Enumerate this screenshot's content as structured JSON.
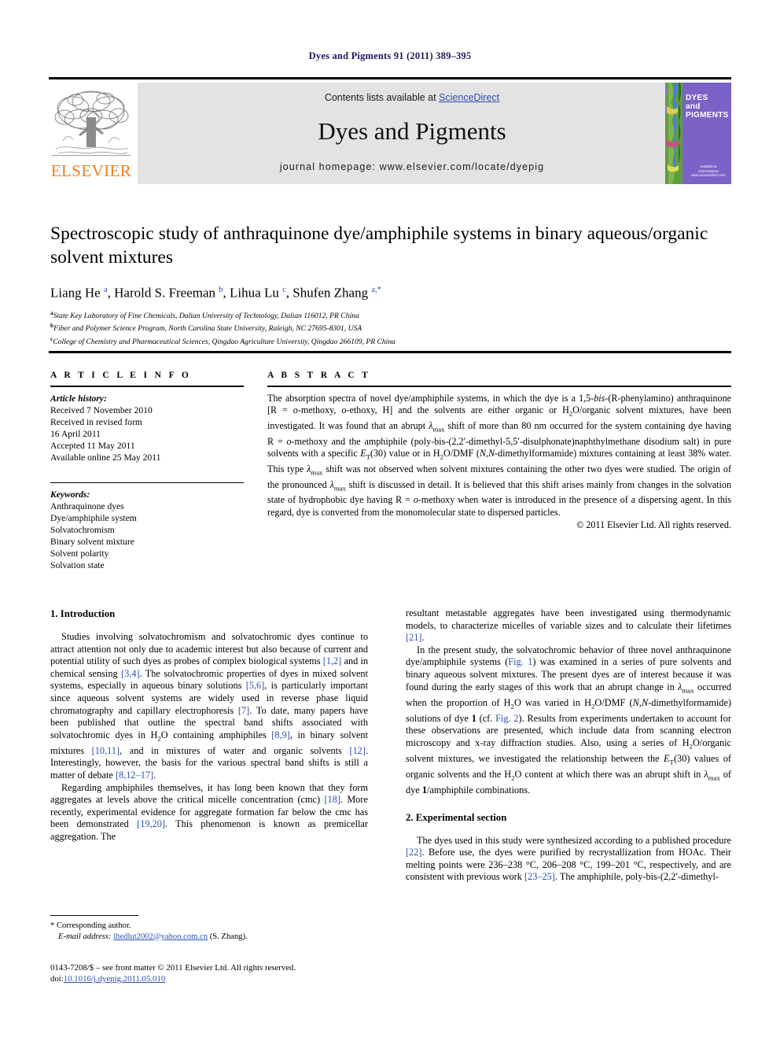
{
  "running_head": "Dyes and Pigments 91 (2011) 389–395",
  "masthead": {
    "contents_prefix": "Contents lists available at ",
    "sciencedirect": "ScienceDirect",
    "journal_title": "Dyes and Pigments",
    "homepage": "journal homepage: www.elsevier.com/locate/dyepig",
    "publisher_name": "ELSEVIER",
    "cover_title": "DYES and PIGMENTS",
    "cover_footer": "available at ScienceDirect  www.sciencedirect.com",
    "link_color": "#2b50b0",
    "elsevier_orange": "#ef7d20",
    "cover_purple": "#7b62c6",
    "band_gray": "#e3e3e3"
  },
  "title": "Spectroscopic study of anthraquinone dye/amphiphile systems in binary aqueous/organic solvent mixtures",
  "authors_html": "Liang He <sup>a</sup>, Harold S. Freeman <sup>b</sup>, Lihua Lu <sup>c</sup>, Shufen Zhang <sup>a,*</sup>",
  "affiliations": [
    {
      "marker": "a",
      "text": "State Key Laboratory of Fine Chemicals, Dalian University of Technology, Dalian 116012, PR China"
    },
    {
      "marker": "b",
      "text": "Fiber and Polymer Science Program, North Carolina State University, Raleigh, NC 27695-8301, USA"
    },
    {
      "marker": "c",
      "text": "College of Chemistry and Pharmaceutical Sciences, Qingdao Agriculture University, Qingdao 266109, PR China"
    }
  ],
  "article_info": {
    "heading": "A R T I C L E   I N F O",
    "history_label": "Article history:",
    "history": [
      "Received 7 November 2010",
      "Received in revised form",
      "16 April 2011",
      "Accepted 11 May 2011",
      "Available online 25 May 2011"
    ],
    "keywords_label": "Keywords:",
    "keywords": [
      "Anthraquinone dyes",
      "Dye/amphiphile system",
      "Solvatochromism",
      "Binary solvent mixture",
      "Solvent polarity",
      "Solvation state"
    ]
  },
  "abstract": {
    "heading": "A B S T R A C T",
    "body_html": "The absorption spectra of novel dye/amphiphile systems, in which the dye is a 1,5-<i>bis</i>-(R-phenylamino) anthraquinone [R&nbsp;=&nbsp;<i>o</i>-methoxy, <i>o</i>-ethoxy, H] and the solvents are either organic or H<sub>2</sub>O/organic solvent mixtures, have been investigated. It was found that an abrupt <i>&lambda;</i><sub>max</sub> shift of more than 80&nbsp;nm occurred for the system containing dye having R&nbsp;=&nbsp;<i>o</i>-methoxy and the amphiphile (poly-bis-(2,2&prime;-dimethyl-5,5&prime;-disulphonate)naphthylmethane disodium salt) in pure solvents with a specific <i>E</i><sub>T</sub>(30) value or in H<sub>2</sub>O/DMF (<i>N</i>,<i>N</i>-dimethylformamide) mixtures containing at least 38% water. This type <i>&lambda;</i><sub>max</sub> shift was not observed when solvent mixtures containing the other two dyes were studied. The origin of the pronounced <i>&lambda;</i><sub>max</sub> shift is discussed in detail. It is believed that this shift arises mainly from changes in the solvation state of hydrophobic dye having R&nbsp;=&nbsp;<i>o</i>-methoxy when water is introduced in the presence of a dispersing agent. In this regard, dye is converted from the monomolecular state to dispersed particles.",
    "copyright": "© 2011 Elsevier Ltd. All rights reserved."
  },
  "body": {
    "intro_heading": "1.  Introduction",
    "intro_p1_html": "Studies involving solvatochromism and solvatochromic dyes continue to attract attention not only due to academic interest but also because of current and potential utility of such dyes as probes of complex biological systems <span class=\"ref\">[1,2]</span> and in chemical sensing <span class=\"ref\">[3,4]</span>. The solvatochromic properties of dyes in mixed solvent systems, especially in aqueous binary solutions <span class=\"ref\">[5,6]</span>, is particularly important since aqueous solvent systems are widely used in reverse phase liquid chromatography and capillary electrophoresis <span class=\"ref\">[7]</span>. To date, many papers have been published that outline the spectral band shifts associated with solvatochromic dyes in H<sub>2</sub>O containing amphiphiles <span class=\"ref\">[8,9]</span>, in binary solvent mixtures <span class=\"ref\">[10,11]</span>, and in mixtures of water and organic solvents <span class=\"ref\">[12]</span>. Interestingly, however, the basis for the various spectral band shifts is still a matter of debate <span class=\"ref\">[8,12–17]</span>.",
    "intro_p2_html": "Regarding amphiphiles themselves, it has long been known that they form aggregates at levels above the critical micelle concentration (cmc) <span class=\"ref\">[18]</span>. More recently, experimental evidence for aggregate formation far below the cmc has been demonstrated <span class=\"ref\">[19,20]</span>. This phenomenon is known as premicellar aggregation. The",
    "intro_p2_cont_html": "resultant metastable aggregates have been investigated using thermodynamic models, to characterize micelles of variable sizes and to calculate their lifetimes <span class=\"ref\">[21]</span>.",
    "intro_p3_html": "In the present study, the solvatochromic behavior of three novel anthraquinone dye/amphiphile systems (<span class=\"ref\">Fig. 1</span>) was examined in a series of pure solvents and binary aqueous solvent mixtures. The present dyes are of interest because it was found during the early stages of this work that an abrupt change in <i>&lambda;</i><sub>max</sub> occurred when the proportion of H<sub>2</sub>O was varied in H<sub>2</sub>O/DMF (<i>N</i>,<i>N</i>-dimethylformamide) solutions of dye <b>1</b> (cf. <span class=\"ref\">Fig. 2</span>). Results from experiments undertaken to account for these observations are presented, which include data from scanning electron microscopy and x-ray diffraction studies. Also, using a series of H<sub>2</sub>O/organic solvent mixtures, we investigated the relationship between the <i>E</i><sub>T</sub>(30) values of organic solvents and the H<sub>2</sub>O content at which there was an abrupt shift in <i>&lambda;</i><sub>max</sub> of dye <b>1</b>/amphiphile combinations.",
    "exp_heading": "2.  Experimental section",
    "exp_p1_html": "The dyes used in this study were synthesized according to a published procedure <span class=\"ref\">[22]</span>. Before use, the dyes were purified by recrystallization from HOAc. Their melting points were 236–238&nbsp;&deg;C, 206–208&nbsp;&deg;C, 199–201&nbsp;&deg;C, respectively, and are consistent with previous work <span class=\"ref\">[23–25]</span>. The amphiphile, poly-bis-(2,2&prime;-dimethyl-"
  },
  "footnote": {
    "corresponding": "* Corresponding author.",
    "email_label": "E-mail address:",
    "email": "lhedlut2002@yahoo.com.cn",
    "email_owner": "(S. Zhang)."
  },
  "footer": {
    "issn_line": "0143-7208/$ – see front matter © 2011 Elsevier Ltd. All rights reserved.",
    "doi_label": "doi:",
    "doi": "10.1016/j.dyepig.2011.05.010"
  }
}
